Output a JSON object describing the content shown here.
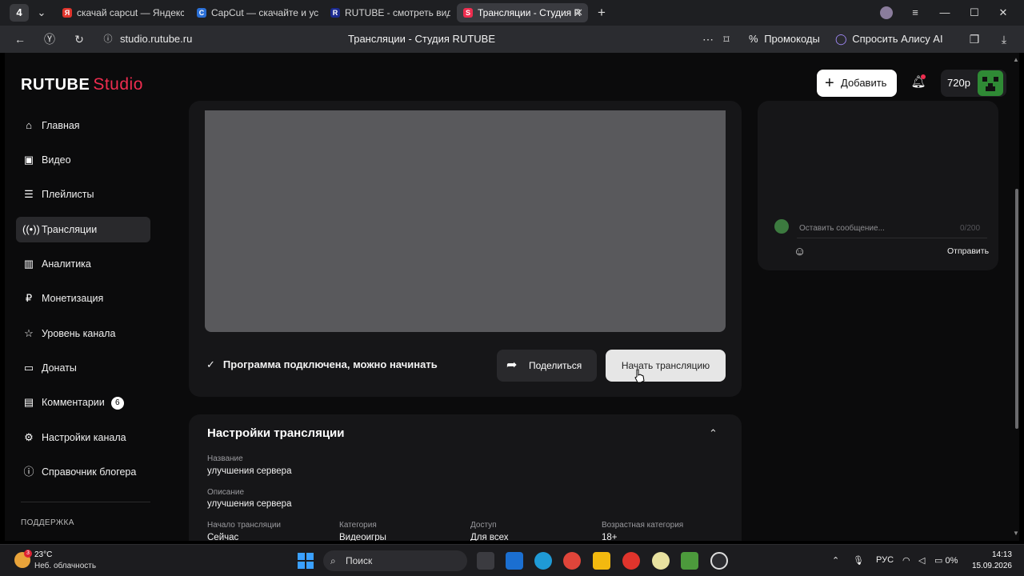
{
  "browser": {
    "tab_count": "4",
    "tabs": [
      {
        "label": "скачай capcut — Яндекс",
        "fav": "Я",
        "fav_color": "#e0342c"
      },
      {
        "label": "CapCut — скачайте и уст",
        "fav": "C",
        "fav_color": "#2a6fd6"
      },
      {
        "label": "RUTUBE - смотреть виде",
        "fav": "R",
        "fav_color": "#1b2a8f"
      },
      {
        "label": "Трансляции - Студия R",
        "fav": "S",
        "fav_color": "#ee2d4f"
      }
    ],
    "url": "studio.rutube.ru",
    "page_title": "Трансляции - Студия RUTUBE",
    "promo_label": "Промокоды",
    "alice_label": "Спросить Алису AI"
  },
  "app": {
    "logo_main": "RUTUBE",
    "logo_studio": "Studio",
    "add_label": "Добавить",
    "quality_label": "720p",
    "accent_color": "#ee2d4f"
  },
  "sidebar": {
    "items": [
      {
        "label": "Главная",
        "icon": "home-icon"
      },
      {
        "label": "Видео",
        "icon": "video-icon"
      },
      {
        "label": "Плейлисты",
        "icon": "playlist-icon"
      },
      {
        "label": "Трансляции",
        "icon": "broadcast-icon",
        "active": true
      },
      {
        "label": "Аналитика",
        "icon": "analytics-icon"
      },
      {
        "label": "Монетизация",
        "icon": "ruble-icon"
      },
      {
        "label": "Уровень канала",
        "icon": "star-icon"
      },
      {
        "label": "Донаты",
        "icon": "donate-icon"
      },
      {
        "label": "Комментарии",
        "icon": "comment-icon",
        "badge": "6"
      },
      {
        "label": "Настройки канала",
        "icon": "gear-icon"
      },
      {
        "label": "Справочник блогера",
        "icon": "info-icon"
      }
    ],
    "support_label": "ПОДДЕРЖКА"
  },
  "stream": {
    "status_text": "Программа подключена, можно начинать",
    "share_label": "Поделиться",
    "start_label": "Начать трансляцию"
  },
  "settings": {
    "title": "Настройки трансляции",
    "name_label": "Название",
    "name_value": "улучшения сервера",
    "desc_label": "Описание",
    "desc_value": "улучшения сервера",
    "start_label": "Начало трансляции",
    "start_value": "Сейчас",
    "category_label": "Категория",
    "category_value": "Видеоигры",
    "access_label": "Доступ",
    "access_value": "Для всех",
    "age_label": "Возрастная категория",
    "age_value": "18+"
  },
  "chat": {
    "placeholder": "Оставить сообщение...",
    "counter": "0/200",
    "send_label": "Отправить"
  },
  "taskbar": {
    "temperature": "23°C",
    "weather": "Неб. облачность",
    "weather_badge": "3",
    "search_label": "Поиск",
    "lang": "РУС",
    "battery": "0%",
    "time": "14:13",
    "date": "15.09.2026"
  }
}
